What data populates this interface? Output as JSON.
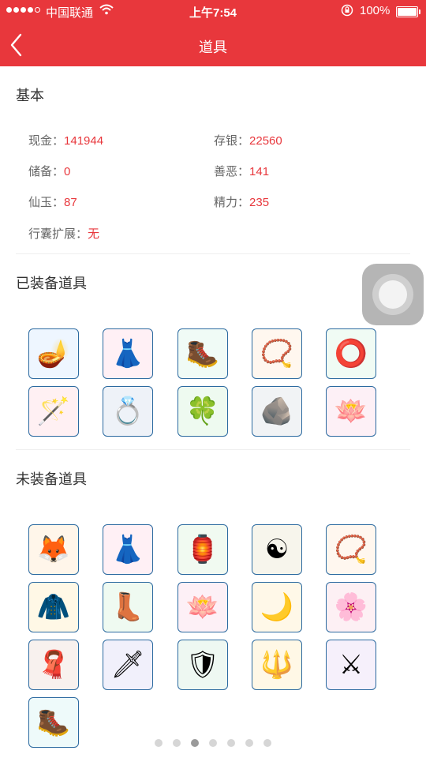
{
  "status": {
    "carrier": "中国联通",
    "time": "上午7:54",
    "battery": "100%"
  },
  "nav": {
    "title": "道具",
    "back_icon": "chevron-left-icon"
  },
  "basic": {
    "title": "基本",
    "fields": [
      {
        "label": "现金：",
        "value": "141944"
      },
      {
        "label": "存银：",
        "value": "22560"
      },
      {
        "label": "储备：",
        "value": "0"
      },
      {
        "label": "善恶：",
        "value": "141"
      },
      {
        "label": "仙玉：",
        "value": "87"
      },
      {
        "label": "精力：",
        "value": "235"
      },
      {
        "label": "行囊扩展：",
        "value": "无"
      }
    ]
  },
  "equipped": {
    "title": "已装备道具",
    "items": [
      {
        "icon": "lamp-icon",
        "glyph": "🪔",
        "bg": "#eef6ff"
      },
      {
        "icon": "skirt-icon",
        "glyph": "👗",
        "bg": "#fff0f5"
      },
      {
        "icon": "boots-icon",
        "glyph": "🥾",
        "bg": "#f0fbf6"
      },
      {
        "icon": "pendant-icon",
        "glyph": "📿",
        "bg": "#fff7ef"
      },
      {
        "icon": "bracelet-icon",
        "glyph": "⭕",
        "bg": "#f0fbf4"
      },
      {
        "icon": "staff-icon",
        "glyph": "🪄",
        "bg": "#fff0f3"
      },
      {
        "icon": "ring-icon",
        "glyph": "💍",
        "bg": "#eef2f8"
      },
      {
        "icon": "jade-pendant-icon",
        "glyph": "🍀",
        "bg": "#eefaf0"
      },
      {
        "icon": "stone-ring-icon",
        "glyph": "🪨",
        "bg": "#f1f3f5"
      },
      {
        "icon": "lotus-icon",
        "glyph": "🪷",
        "bg": "#fdf0f6"
      }
    ]
  },
  "unequipped": {
    "title": "未装备道具",
    "items": [
      {
        "icon": "fox-mask-icon",
        "glyph": "🦊",
        "bg": "#fff6ea"
      },
      {
        "icon": "skirt-icon",
        "glyph": "👗",
        "bg": "#fff0f5"
      },
      {
        "icon": "tassel-icon",
        "glyph": "🏮",
        "bg": "#f1faf1"
      },
      {
        "icon": "bagua-belt-icon",
        "glyph": "☯",
        "bg": "#f7f5ec"
      },
      {
        "icon": "pendant-icon",
        "glyph": "📿",
        "bg": "#fff7ef"
      },
      {
        "icon": "robe-icon",
        "glyph": "🧥",
        "bg": "#fff8e6"
      },
      {
        "icon": "boots-icon",
        "glyph": "👢",
        "bg": "#effaf1"
      },
      {
        "icon": "lotus-icon",
        "glyph": "🪷",
        "bg": "#fdf0f6"
      },
      {
        "icon": "earring-icon",
        "glyph": "🌙",
        "bg": "#fff8e8"
      },
      {
        "icon": "flower-ring-icon",
        "glyph": "🌸",
        "bg": "#fdf0f4"
      },
      {
        "icon": "scarf-icon",
        "glyph": "🧣",
        "bg": "#f8f1ee"
      },
      {
        "icon": "dagger-icon",
        "glyph": "🗡",
        "bg": "#f1f0fb"
      },
      {
        "icon": "armor-icon",
        "glyph": "🛡",
        "bg": "#eef8f2"
      },
      {
        "icon": "golden-staff-icon",
        "glyph": "🔱",
        "bg": "#fff8e6"
      },
      {
        "icon": "purple-sword-icon",
        "glyph": "⚔",
        "bg": "#f6f0fb"
      },
      {
        "icon": "teal-boots-icon",
        "glyph": "🥾",
        "bg": "#eefafa"
      }
    ]
  },
  "pager": {
    "count": 7,
    "active": 2
  }
}
